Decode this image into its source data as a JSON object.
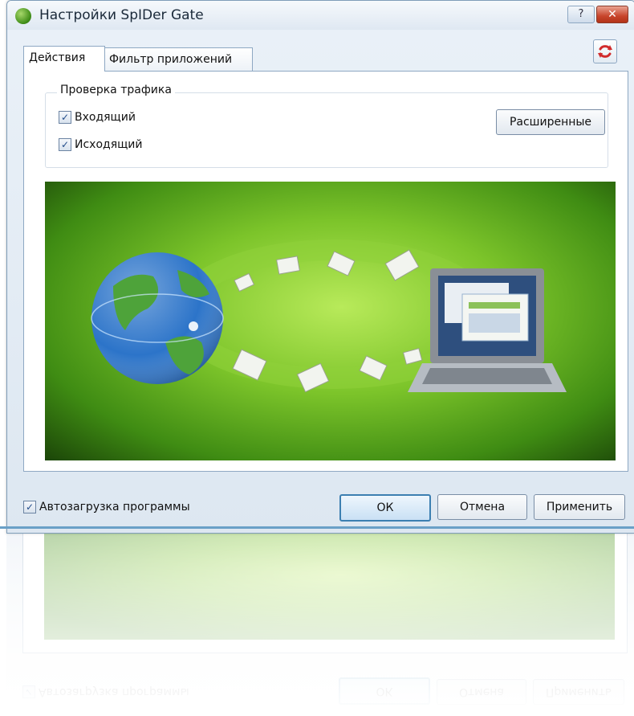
{
  "window": {
    "title": "Настройки SpIDer Gate",
    "help_glyph": "?",
    "close_glyph": "✕"
  },
  "tabs": [
    {
      "label": "Действия",
      "active": true
    },
    {
      "label": "Фильтр приложений",
      "active": false
    }
  ],
  "traffic_group": {
    "title": "Проверка трафика",
    "checkboxes": [
      {
        "label": "Входящий",
        "checked": true
      },
      {
        "label": "Исходящий",
        "checked": true
      }
    ],
    "advanced_button": "Расширенные"
  },
  "footer": {
    "autostart_label": "Автозагрузка программы",
    "autostart_checked": true,
    "ok_label": "ОК",
    "cancel_label": "Отмена",
    "apply_label": "Применить"
  },
  "icons": {
    "app": "spider-gate-app-icon",
    "reset": "reset-icon",
    "checkmark": "✓"
  },
  "colors": {
    "accent_blue": "#3c7fb1",
    "banner_green": "#7cc42a",
    "close_red": "#c8452c"
  }
}
